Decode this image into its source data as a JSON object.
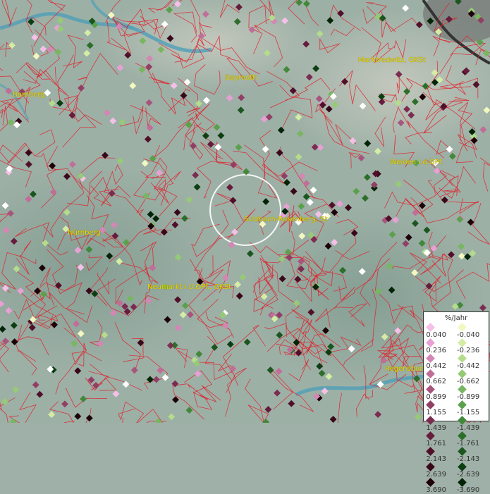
{
  "cities": [
    {
      "name": "Bamberg"
    },
    {
      "name": "Bayreuth"
    },
    {
      "name": "Marktredwitz, GKSt"
    },
    {
      "name": "Weiden i.d.OPf."
    },
    {
      "name": "Sulzbach-Rosenberg, St"
    },
    {
      "name": "Nürnberg"
    },
    {
      "name": "Neumarkt i.d.OPf., GKSt"
    },
    {
      "name": "Regensburg"
    }
  ],
  "legend": {
    "unit": "%/Jahr",
    "positive": [
      {
        "label": "0.040",
        "color": "#f4c0e8"
      },
      {
        "label": "0.236",
        "color": "#e8a0d4"
      },
      {
        "label": "0.442",
        "color": "#d486b4"
      },
      {
        "label": "0.662",
        "color": "#c06e98"
      },
      {
        "label": "0.899",
        "color": "#a8557e"
      },
      {
        "label": "1.155",
        "color": "#923f66"
      },
      {
        "label": "1.439",
        "color": "#7c2c50"
      },
      {
        "label": "1.761",
        "color": "#661c3c"
      },
      {
        "label": "2.143",
        "color": "#50102a"
      },
      {
        "label": "2.639",
        "color": "#38081a"
      },
      {
        "label": "3.690",
        "color": "#1c0008"
      }
    ],
    "negative": [
      {
        "label": "-0.040",
        "color": "#f2f8c0"
      },
      {
        "label": "-0.236",
        "color": "#d4eca4"
      },
      {
        "label": "-0.442",
        "color": "#b4dc8c"
      },
      {
        "label": "-0.662",
        "color": "#96ca76"
      },
      {
        "label": "-0.899",
        "color": "#78b660"
      },
      {
        "label": "-1.155",
        "color": "#5ca04c"
      },
      {
        "label": "-1.439",
        "color": "#42883a"
      },
      {
        "label": "-1.761",
        "color": "#2c6e2a"
      },
      {
        "label": "-2.143",
        "color": "#1a561e"
      },
      {
        "label": "-2.639",
        "color": "#0c3e12"
      },
      {
        "label": "-3.690",
        "color": "#042408"
      }
    ]
  },
  "selection_circle": {
    "label": "Sulzbach-Rosenberg, St"
  }
}
